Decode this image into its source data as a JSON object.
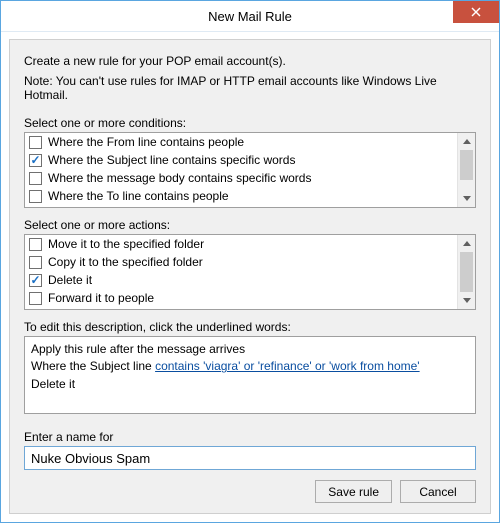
{
  "window": {
    "title": "New Mail Rule"
  },
  "intro": "Create a new rule for your POP email account(s).",
  "note": "Note: You can't use rules for IMAP or HTTP email accounts like Windows Live Hotmail.",
  "conditions": {
    "label": "Select one or more conditions:",
    "items": [
      {
        "label": "Where the From line contains people",
        "checked": false
      },
      {
        "label": "Where the Subject line contains specific words",
        "checked": true
      },
      {
        "label": "Where the message body contains specific words",
        "checked": false
      },
      {
        "label": "Where the To line contains people",
        "checked": false
      }
    ]
  },
  "actions": {
    "label": "Select one or more actions:",
    "items": [
      {
        "label": "Move it to the specified folder",
        "checked": false
      },
      {
        "label": "Copy it to the specified folder",
        "checked": false
      },
      {
        "label": "Delete it",
        "checked": true
      },
      {
        "label": "Forward it to people",
        "checked": false
      }
    ]
  },
  "description": {
    "label": "To edit this description, click the underlined words:",
    "line1": "Apply this rule after the message arrives",
    "line2_prefix": "Where the Subject line ",
    "line2_link": "contains 'viagra' or 'refinance' or 'work from home'",
    "line3": "Delete it"
  },
  "name": {
    "label": "Enter a name for",
    "value": "Nuke Obvious Spam"
  },
  "buttons": {
    "save": "Save rule",
    "cancel": "Cancel"
  }
}
